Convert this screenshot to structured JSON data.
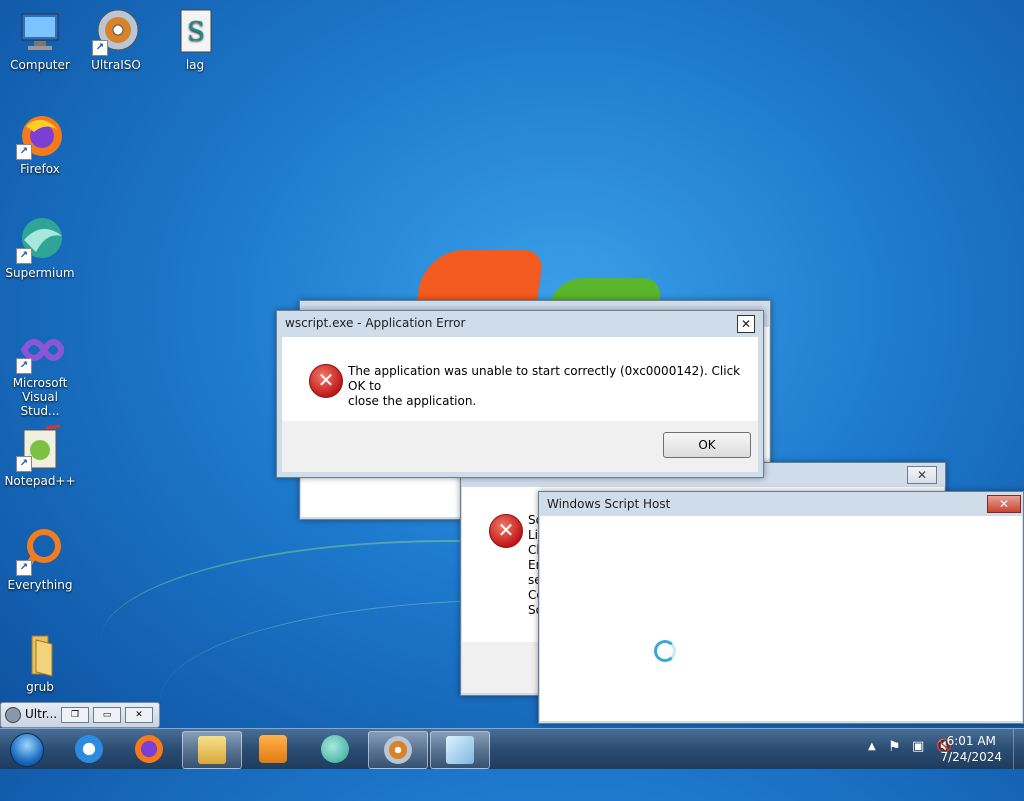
{
  "desktop": {
    "icons": [
      {
        "label": "Computer"
      },
      {
        "label": "UltraISO"
      },
      {
        "label": "lag"
      },
      {
        "label": "Firefox"
      },
      {
        "label": "Supermium"
      },
      {
        "label": "Microsoft Visual Stud..."
      },
      {
        "label": "Notepad++"
      },
      {
        "label": "Everything"
      },
      {
        "label": "grub"
      }
    ]
  },
  "app_error_dialog": {
    "title": "wscript.exe - Application Error",
    "message_line1": "The application was unable to start correctly (0xc0000142). Click OK to",
    "message_line2": "close the application.",
    "ok_label": "OK",
    "close_glyph": "✕"
  },
  "behind_dialog": {
    "partial_lines": [
      "So",
      "Li",
      "Cl",
      "Er",
      "se",
      "Co",
      "So"
    ],
    "close_glyph": "✕"
  },
  "wsh_window": {
    "title": "Windows Script Host",
    "close_glyph": "✕"
  },
  "minimized_window": {
    "label": "Ultr..."
  },
  "taskbar": {
    "time": "6:01 AM",
    "date": "7/24/2024"
  },
  "colors": {
    "error_red": "#c01818",
    "taskbar": "#2b4c73"
  }
}
